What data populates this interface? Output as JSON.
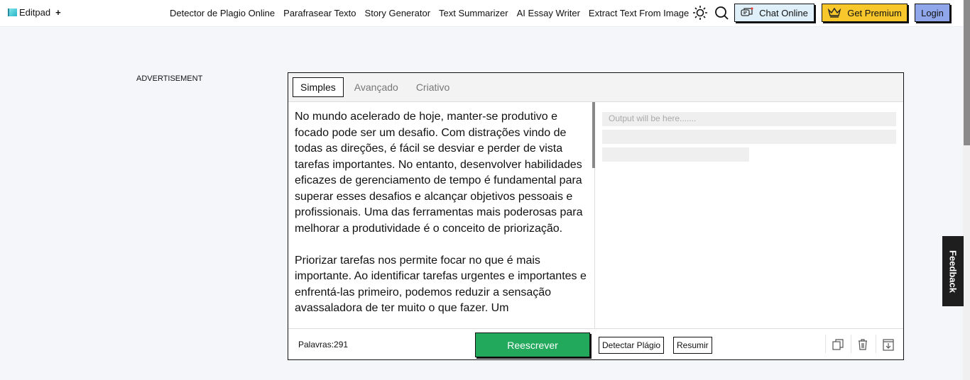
{
  "header": {
    "logo": "Editpad",
    "plus": "+",
    "nav": [
      "Detector de Plagio Online",
      "Parafrasear Texto",
      "Story Generator",
      "Text Summarizer",
      "AI Essay Writer",
      "Extract Text From Image"
    ],
    "chat": "Chat Online",
    "premium": "Get Premium",
    "login": "Login"
  },
  "ad": "ADVERTISEMENT",
  "editor": {
    "tabs": [
      "Simples",
      "Avançado",
      "Criativo"
    ],
    "paragraphs": [
      "No mundo acelerado de hoje, manter-se produtivo e focado pode ser um desafio. Com distrações vindo de todas as direções, é fácil se desviar e perder de vista tarefas importantes. No entanto, desenvolver habilidades eficazes de gerenciamento de tempo é fundamental para superar esses desafios e alcançar objetivos pessoais e profissionais. Uma das ferramentas mais poderosas para melhorar a produtividade é o conceito de priorização.",
      "Priorizar tarefas nos permite focar no que é mais importante. Ao identificar tarefas urgentes e importantes e enfrentá-las primeiro, podemos reduzir a sensação avassaladora de ter muito o que fazer. Um"
    ],
    "output_placeholder": "Output will be here.......",
    "words": "Palavras:291",
    "rewrite": "Reescrever",
    "plagiarism": "Detectar Plágio",
    "summarize": "Resumir"
  },
  "feedback": "Feedback"
}
